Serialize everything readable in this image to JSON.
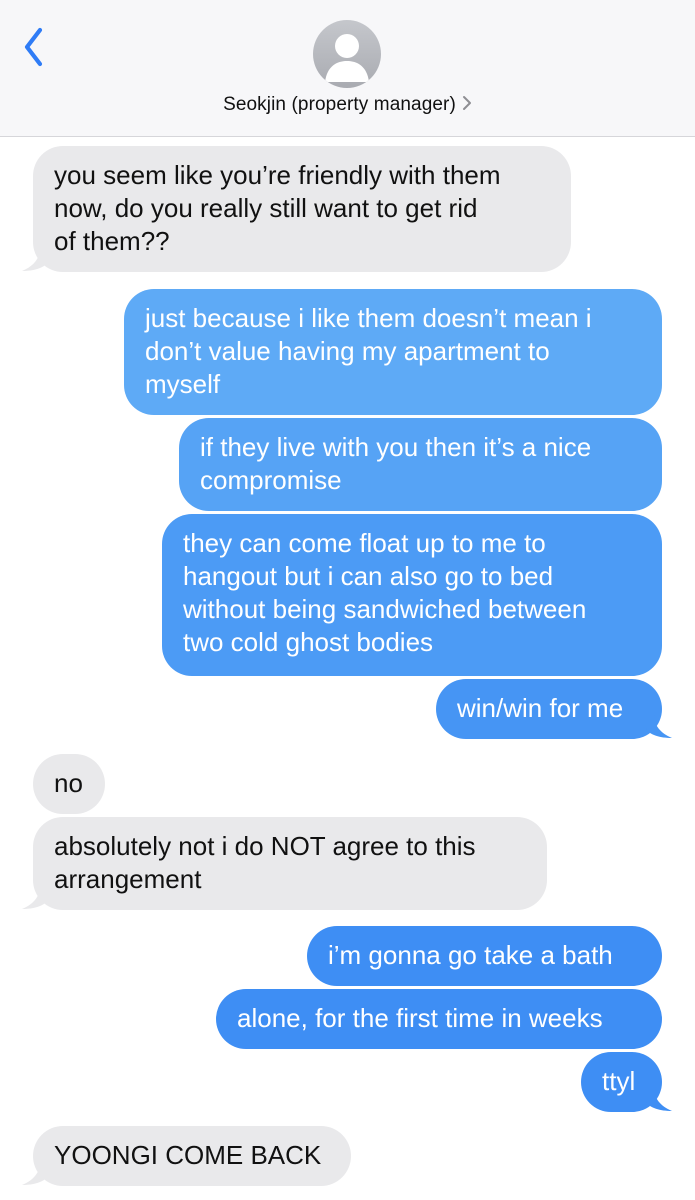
{
  "header": {
    "back_icon": "chevron-left-icon",
    "avatar_icon": "person-icon",
    "contact_name": "Seokjin (property manager)",
    "contact_chevron_icon": "chevron-right-icon"
  },
  "colors": {
    "incoming_bubble": "#e9e9eb",
    "outgoing_bubble": "#3e8ef4",
    "ios_blue": "#2f7cf6"
  },
  "messages": [
    {
      "sender": "them",
      "text": "you seem like you’re friendly with them\nnow, do you really still want to get rid\nof them??"
    },
    {
      "sender": "me",
      "text": "just because i like them doesn’t mean i\ndon’t value having my apartment to\nmyself"
    },
    {
      "sender": "me",
      "text": "if they live with you then it’s a nice\ncompromise"
    },
    {
      "sender": "me",
      "text": "they can come float up to me to\nhangout but i can also go to bed\nwithout being sandwiched between\ntwo cold ghost bodies"
    },
    {
      "sender": "me",
      "text": "win/win for me"
    },
    {
      "sender": "them",
      "text": "no"
    },
    {
      "sender": "them",
      "text": "absolutely not i do NOT agree to this\narrangement"
    },
    {
      "sender": "me",
      "text": "i’m gonna go take a bath"
    },
    {
      "sender": "me",
      "text": "alone, for the first time in weeks"
    },
    {
      "sender": "me",
      "text": "ttyl"
    },
    {
      "sender": "them",
      "text": "YOONGI COME BACK"
    }
  ]
}
